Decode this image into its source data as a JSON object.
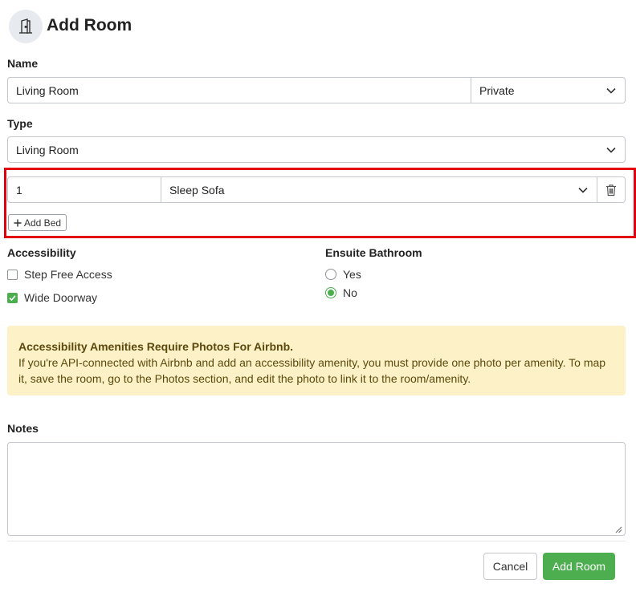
{
  "header": {
    "title": "Add Room",
    "icon": "door-icon"
  },
  "name": {
    "label": "Name",
    "value": "Living Room",
    "privacy": "Private"
  },
  "type": {
    "label": "Type",
    "value": "Living Room"
  },
  "beds": [
    {
      "quantity": "1",
      "bed_type": "Sleep Sofa"
    }
  ],
  "add_bed_label": "Add Bed",
  "accessibility": {
    "label": "Accessibility",
    "options": [
      {
        "label": "Step Free Access",
        "checked": false
      },
      {
        "label": "Wide Doorway",
        "checked": true
      }
    ]
  },
  "ensuite": {
    "label": "Ensuite Bathroom",
    "options": [
      {
        "label": "Yes",
        "selected": false
      },
      {
        "label": "No",
        "selected": true
      }
    ]
  },
  "alert": {
    "heading": "Accessibility Amenities Require Photos For Airbnb.",
    "body": "If you're API-connected with Airbnb and add an accessibility amenity, you must provide one photo per amenity. To map it, save the room, go to the Photos section, and edit the photo to link it to the room/amenity."
  },
  "notes": {
    "label": "Notes",
    "value": ""
  },
  "actions": {
    "cancel": "Cancel",
    "submit": "Add Room"
  },
  "colors": {
    "accent": "#4cae4f",
    "alert_bg": "#fdf1c8",
    "highlight": "#e2000f"
  }
}
